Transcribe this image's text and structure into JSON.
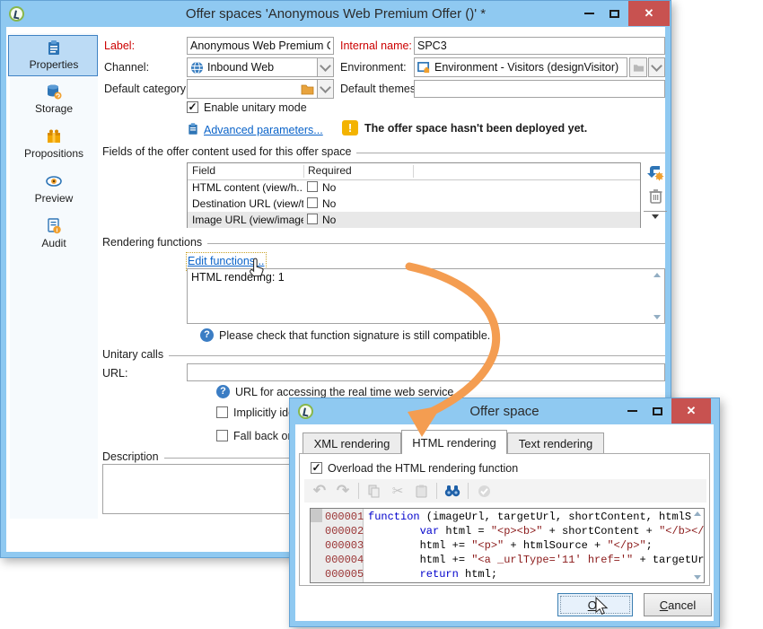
{
  "window": {
    "title": "Offer spaces 'Anonymous Web Premium Offer ()' *",
    "nav": [
      {
        "label": "Properties",
        "icon": "clipboard-icon",
        "selected": true
      },
      {
        "label": "Storage",
        "icon": "database-icon",
        "selected": false
      },
      {
        "label": "Propositions",
        "icon": "gift-icon",
        "selected": false
      },
      {
        "label": "Preview",
        "icon": "eye-icon",
        "selected": false
      },
      {
        "label": "Audit",
        "icon": "audit-icon",
        "selected": false
      }
    ],
    "form": {
      "label": {
        "label": "Label:",
        "value": "Anonymous Web Premium Off"
      },
      "internal_name": {
        "label": "Internal name:",
        "value": "SPC3"
      },
      "channel": {
        "label": "Channel:",
        "value": "Inbound Web"
      },
      "environment": {
        "label": "Environment:",
        "value": "Environment - Visitors (designVisitor)"
      },
      "default_category": {
        "label": "Default category:",
        "value": ""
      },
      "default_themes": {
        "label": "Default themes:",
        "value": ""
      },
      "enable_unitary_label": "Enable unitary mode",
      "advanced_parameters_label": "Advanced parameters...",
      "warning_text": "The offer space hasn't been deployed yet."
    },
    "fields_section": {
      "title": "Fields of the offer content used for this offer space",
      "table": {
        "headers": [
          "Field",
          "Required"
        ],
        "rows": [
          {
            "field": "HTML content (view/h...",
            "required": "No",
            "selected": false
          },
          {
            "field": "Destination URL (view/t...",
            "required": "No",
            "selected": false
          },
          {
            "field": "Image URL (view/image...",
            "required": "No",
            "selected": true
          }
        ]
      }
    },
    "rendering_section": {
      "title": "Rendering functions",
      "edit_link": "Edit functions...",
      "summary": "HTML rendering: 1",
      "note": "Please check that function signature is still compatible."
    },
    "unitary_section": {
      "title": "Unitary calls",
      "url_label": "URL:",
      "url_value": "",
      "url_note": "URL for accessing the real time web service",
      "checkbox_implicit": "Implicitly identify",
      "checkbox_fallback": "Fall back on an an"
    },
    "description_section": {
      "title": "Description",
      "value": ""
    }
  },
  "dialog": {
    "title": "Offer space",
    "tabs": [
      {
        "label": "XML rendering",
        "active": false
      },
      {
        "label": "HTML rendering",
        "active": true
      },
      {
        "label": "Text rendering",
        "active": false
      }
    ],
    "overload_label": "Overload the HTML rendering function",
    "code": {
      "lines": [
        {
          "num": "000001",
          "segs": [
            {
              "t": "k",
              "s": "function"
            },
            {
              "t": "p",
              "s": " (imageUrl, targetUrl, shortContent, htmlS"
            }
          ]
        },
        {
          "num": "000002",
          "segs": [
            {
              "t": "p",
              "s": "        "
            },
            {
              "t": "k",
              "s": "var"
            },
            {
              "t": "p",
              "s": " html = "
            },
            {
              "t": "s",
              "s": "\"<p><b>\""
            },
            {
              "t": "p",
              "s": " + shortContent + "
            },
            {
              "t": "s",
              "s": "\"</b></"
            }
          ]
        },
        {
          "num": "000003",
          "segs": [
            {
              "t": "p",
              "s": "        html += "
            },
            {
              "t": "s",
              "s": "\"<p>\""
            },
            {
              "t": "p",
              "s": " + htmlSource + "
            },
            {
              "t": "s",
              "s": "\"</p>\""
            },
            {
              "t": "p",
              "s": ";"
            }
          ]
        },
        {
          "num": "000004",
          "segs": [
            {
              "t": "p",
              "s": "        html += "
            },
            {
              "t": "s",
              "s": "\"<a _urlType='11' href='\""
            },
            {
              "t": "p",
              "s": " + targetUr"
            }
          ]
        },
        {
          "num": "000005",
          "segs": [
            {
              "t": "p",
              "s": "        "
            },
            {
              "t": "k",
              "s": "return"
            },
            {
              "t": "p",
              "s": " html;"
            }
          ]
        }
      ]
    },
    "buttons": {
      "ok_key": "O",
      "ok_rest": "k",
      "cancel_key": "C",
      "cancel_rest": "ancel"
    }
  },
  "colors": {
    "titlebar": "#8fc9f1",
    "close_red": "#c85250",
    "nav_selected": "#bcdbf5",
    "link_blue": "#0a63c9",
    "label_red": "#cc0000",
    "arrow_orange": "#f49d51",
    "code_keyword": "#0000cc",
    "code_string": "#8b1a1a",
    "line_number": "#9a3333"
  }
}
